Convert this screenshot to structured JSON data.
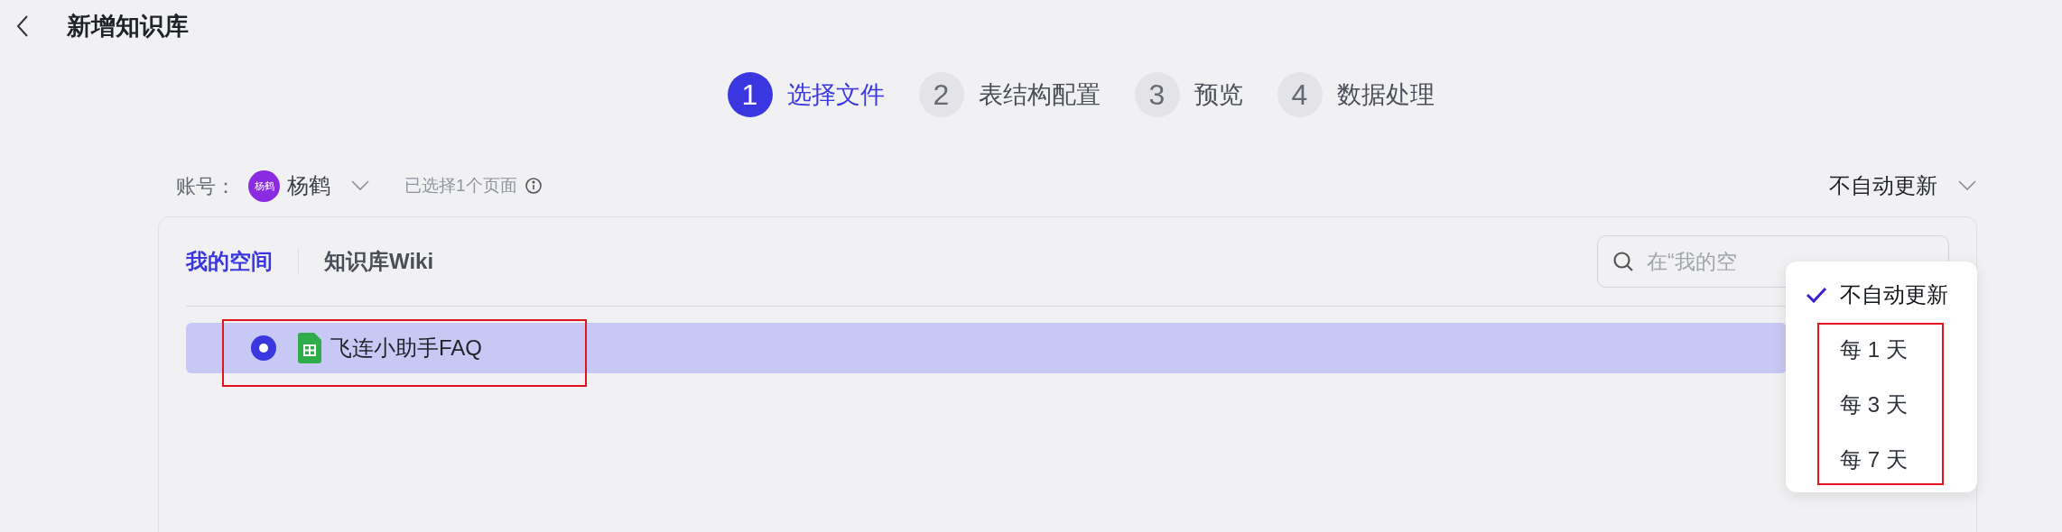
{
  "page_title": "新增知识库",
  "steps": [
    {
      "number": "1",
      "label": "选择文件",
      "selected": true
    },
    {
      "number": "2",
      "label": "表结构配置",
      "selected": false
    },
    {
      "number": "3",
      "label": "预览",
      "selected": false
    },
    {
      "number": "4",
      "label": "数据处理",
      "selected": false
    }
  ],
  "account": {
    "label": "账号：",
    "avatar_text": "杨鹤",
    "name": "杨鹤",
    "selection_note": "已选择1个页面"
  },
  "update_select": {
    "value": "不自动更新",
    "expanded": true
  },
  "tabs": [
    {
      "label": "我的空间",
      "selected": true
    },
    {
      "label": "知识库Wiki",
      "selected": false
    }
  ],
  "search": {
    "placeholder": "在“我的空"
  },
  "files": [
    {
      "name": "飞连小助手FAQ",
      "selected": true
    }
  ],
  "update_menu": [
    {
      "label": "不自动更新",
      "selected": true
    },
    {
      "label": "每 1 天",
      "selected": false
    },
    {
      "label": "每 3 天",
      "selected": false
    },
    {
      "label": "每 7 天",
      "selected": false
    }
  ]
}
